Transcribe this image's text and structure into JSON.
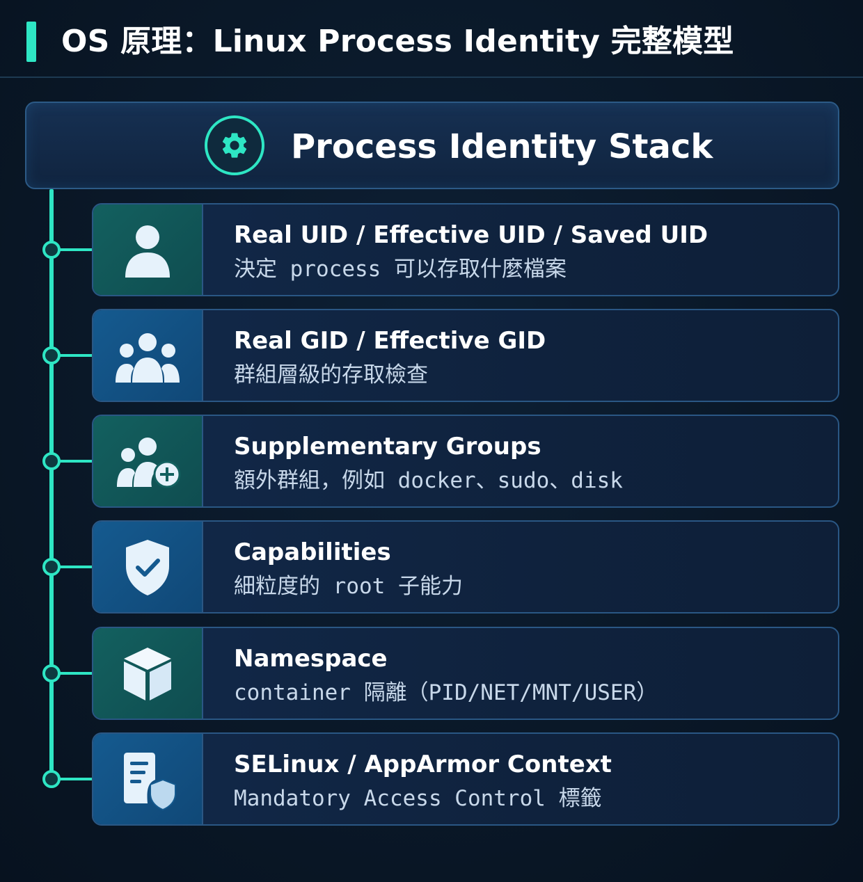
{
  "header": {
    "title": "OS 原理：Linux Process Identity 完整模型"
  },
  "stack": {
    "title": "Process Identity Stack",
    "icon": "gear-icon"
  },
  "layers": [
    {
      "title": "Real UID / Effective UID / Saved UID",
      "desc": "決定 process 可以存取什麼檔案",
      "icon": "user-icon",
      "icon_bg": "teal"
    },
    {
      "title": "Real GID / Effective GID",
      "desc": "群組層級的存取檢查",
      "icon": "group-icon",
      "icon_bg": "blue"
    },
    {
      "title": "Supplementary Groups",
      "desc": "額外群組，例如 docker、sudo、disk",
      "icon": "group-add-icon",
      "icon_bg": "teal"
    },
    {
      "title": "Capabilities",
      "desc": "細粒度的 root 子能力",
      "icon": "shield-check-icon",
      "icon_bg": "blue"
    },
    {
      "title": "Namespace",
      "desc": "container 隔離（PID/NET/MNT/USER）",
      "icon": "cube-icon",
      "icon_bg": "teal"
    },
    {
      "title": "SELinux / AppArmor Context",
      "desc": "Mandatory Access Control 標籤",
      "icon": "document-shield-icon",
      "icon_bg": "blue"
    }
  ],
  "colors": {
    "accent": "#2ee6c4",
    "background": "#0a1828",
    "card_border": "#2a5784",
    "icon_teal": "#13605f",
    "icon_blue": "#155a8f"
  }
}
